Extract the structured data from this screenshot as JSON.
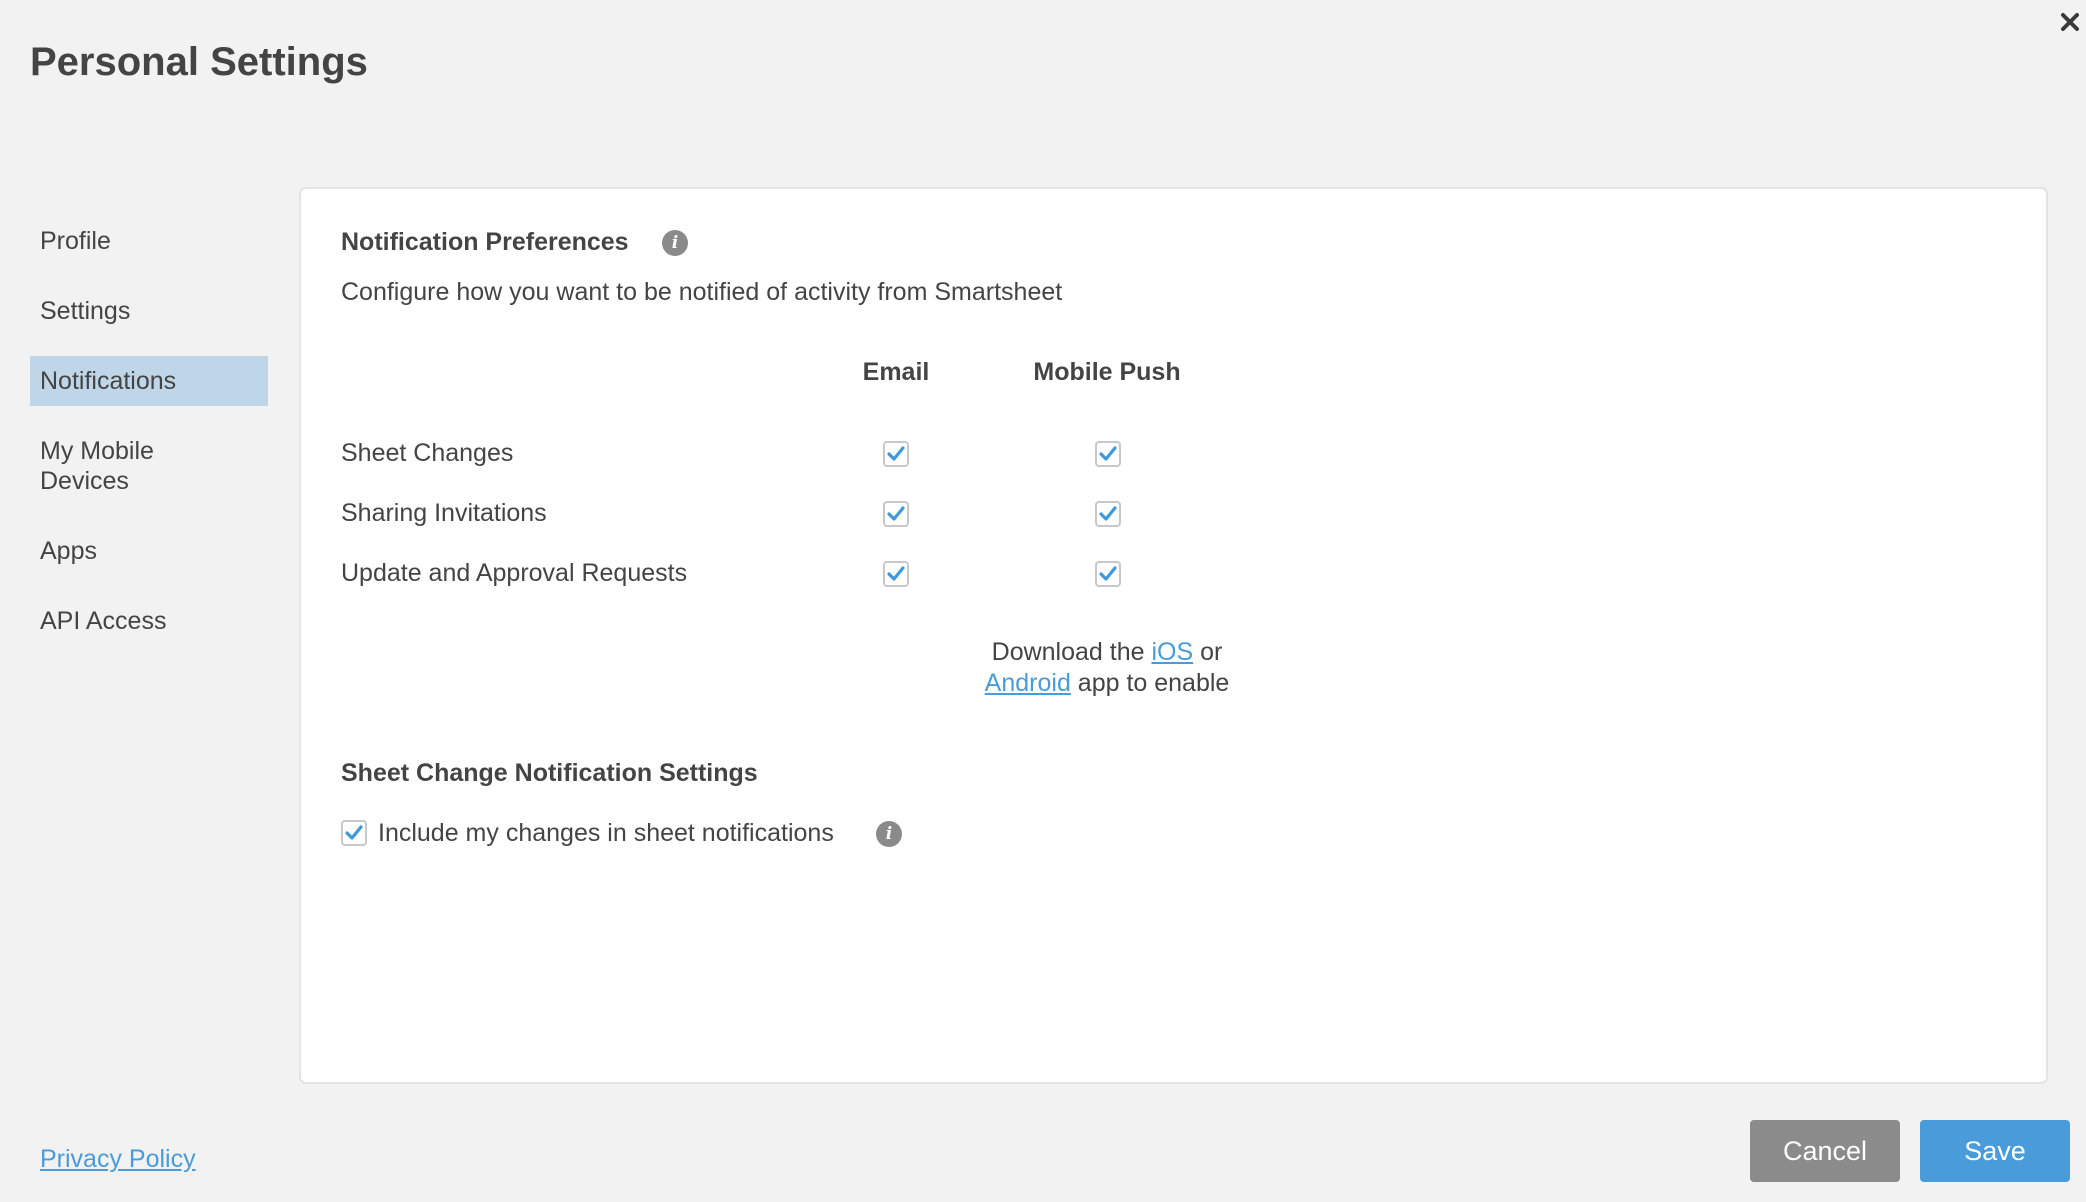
{
  "window": {
    "title": "Personal Settings",
    "close_icon": "close-x-icon"
  },
  "sidebar": {
    "items": [
      {
        "label": "Profile",
        "active": false
      },
      {
        "label": "Settings",
        "active": false
      },
      {
        "label": "Notifications",
        "active": true
      },
      {
        "label": "My Mobile Devices",
        "line1": "My Mobile",
        "line2": "Devices",
        "active": false
      },
      {
        "label": "Apps",
        "active": false
      },
      {
        "label": "API Access",
        "active": false
      }
    ],
    "privacy_link": "Privacy Policy"
  },
  "notifications": {
    "heading": "Notification Preferences",
    "info_icon": "info-icon",
    "description": "Configure how you want to be notified of activity from Smartsheet",
    "columns": [
      "Email",
      "Mobile Push"
    ],
    "rows": [
      {
        "label": "Sheet Changes",
        "email": true,
        "mobile_push": true
      },
      {
        "label": "Sharing Invitations",
        "email": true,
        "mobile_push": true
      },
      {
        "label": "Update and Approval Requests",
        "email": true,
        "mobile_push": true
      }
    ],
    "download": {
      "prefix": "Download the ",
      "ios_link": "iOS",
      "middle": " or",
      "android_link": "Android",
      "suffix": " app to enable"
    }
  },
  "sheet_change": {
    "heading": "Sheet Change Notification Settings",
    "include_label": "Include my changes in sheet notifications",
    "include_checked": true
  },
  "footer": {
    "cancel_label": "Cancel",
    "save_label": "Save"
  },
  "colors": {
    "accent": "#4a9bd9",
    "active_nav": "#bed6e8",
    "cancel_bg": "#8b8b8b",
    "background": "#f2f2f2",
    "text": "#444444"
  }
}
